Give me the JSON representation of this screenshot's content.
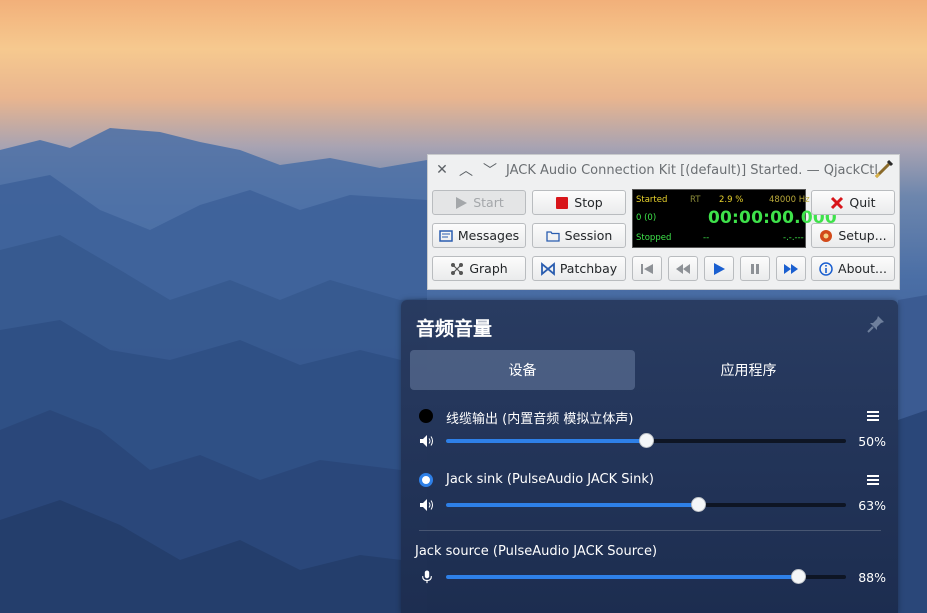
{
  "qjackctl": {
    "title": "JACK Audio Connection Kit [(default)] Started. — QjackCtl",
    "window_controls": [
      "✕",
      "︿",
      "﹀"
    ],
    "buttons": {
      "start": "Start",
      "stop": "Stop",
      "quit": "Quit",
      "messages": "Messages",
      "session": "Session",
      "setup": "Setup...",
      "graph": "Graph",
      "patchbay": "Patchbay",
      "about": "About..."
    },
    "display": {
      "state": "Started",
      "rt": "RT",
      "dsp_load": "2.9 %",
      "sample_rate": "48000 Hz",
      "xruns": "0 (0)",
      "time": "00:00:00.000",
      "transport": "Stopped",
      "bpm": "--",
      "bbt": "-.-.---"
    }
  },
  "volume": {
    "title": "音频音量",
    "tabs": [
      "设备",
      "应用程序"
    ],
    "devices": [
      {
        "name": "线缆输出 (内置音频 模拟立体声)",
        "level": 0.5,
        "percent": "50%",
        "selected": false
      },
      {
        "name": "Jack sink (PulseAudio JACK Sink)",
        "level": 0.63,
        "percent": "63%",
        "selected": true
      }
    ],
    "source": {
      "name": "Jack source (PulseAudio JACK Source)",
      "level": 0.88,
      "percent": "88%"
    }
  },
  "colors": {
    "accent": "#2e80e8",
    "lcd_green": "#3ee24a",
    "lcd_yellow": "#e8d22c",
    "stop_red": "#d8151a"
  }
}
